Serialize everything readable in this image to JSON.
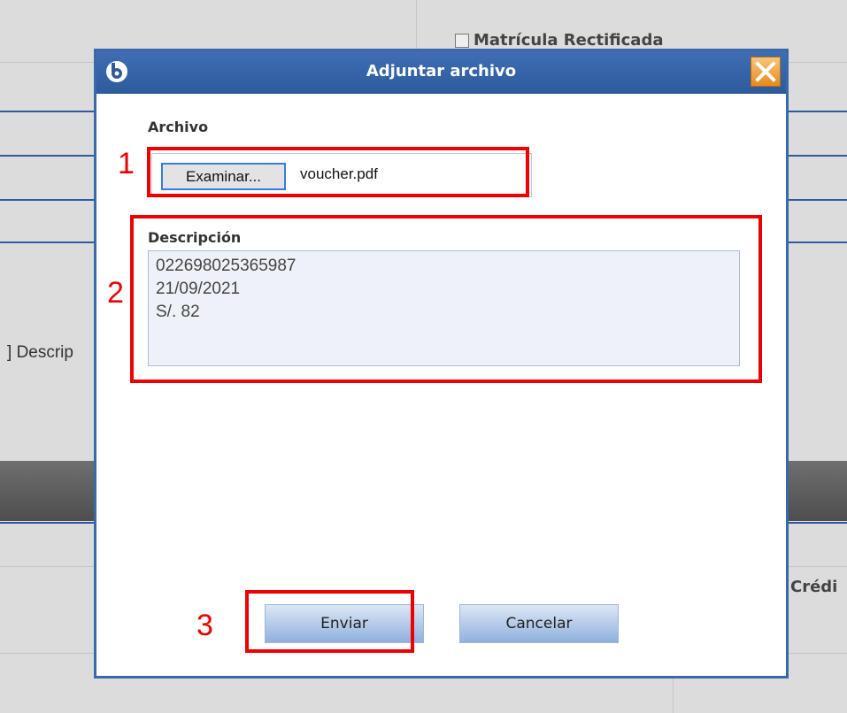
{
  "background": {
    "checkbox_label": "Matrícula Rectificada",
    "left_label": "Descrip",
    "right_label": "Crédi"
  },
  "dialog": {
    "title": "Adjuntar archivo",
    "archivo_label": "Archivo",
    "browse_button": "Examinar...",
    "file_name": "voucher.pdf",
    "descripcion_label": "Descripción",
    "descripcion_value": "022698025365987\n21/09/2021\nS/. 82",
    "submit_button": "Enviar",
    "cancel_button": "Cancelar",
    "icons": {
      "logo": "app-logo-icon",
      "close": "close-icon"
    }
  },
  "annotations": {
    "step1": "1",
    "step2": "2",
    "step3": "3"
  },
  "colors": {
    "titlebar": "#2d5a9c",
    "annotation": "#ee0000",
    "close": "#e88a1c"
  }
}
